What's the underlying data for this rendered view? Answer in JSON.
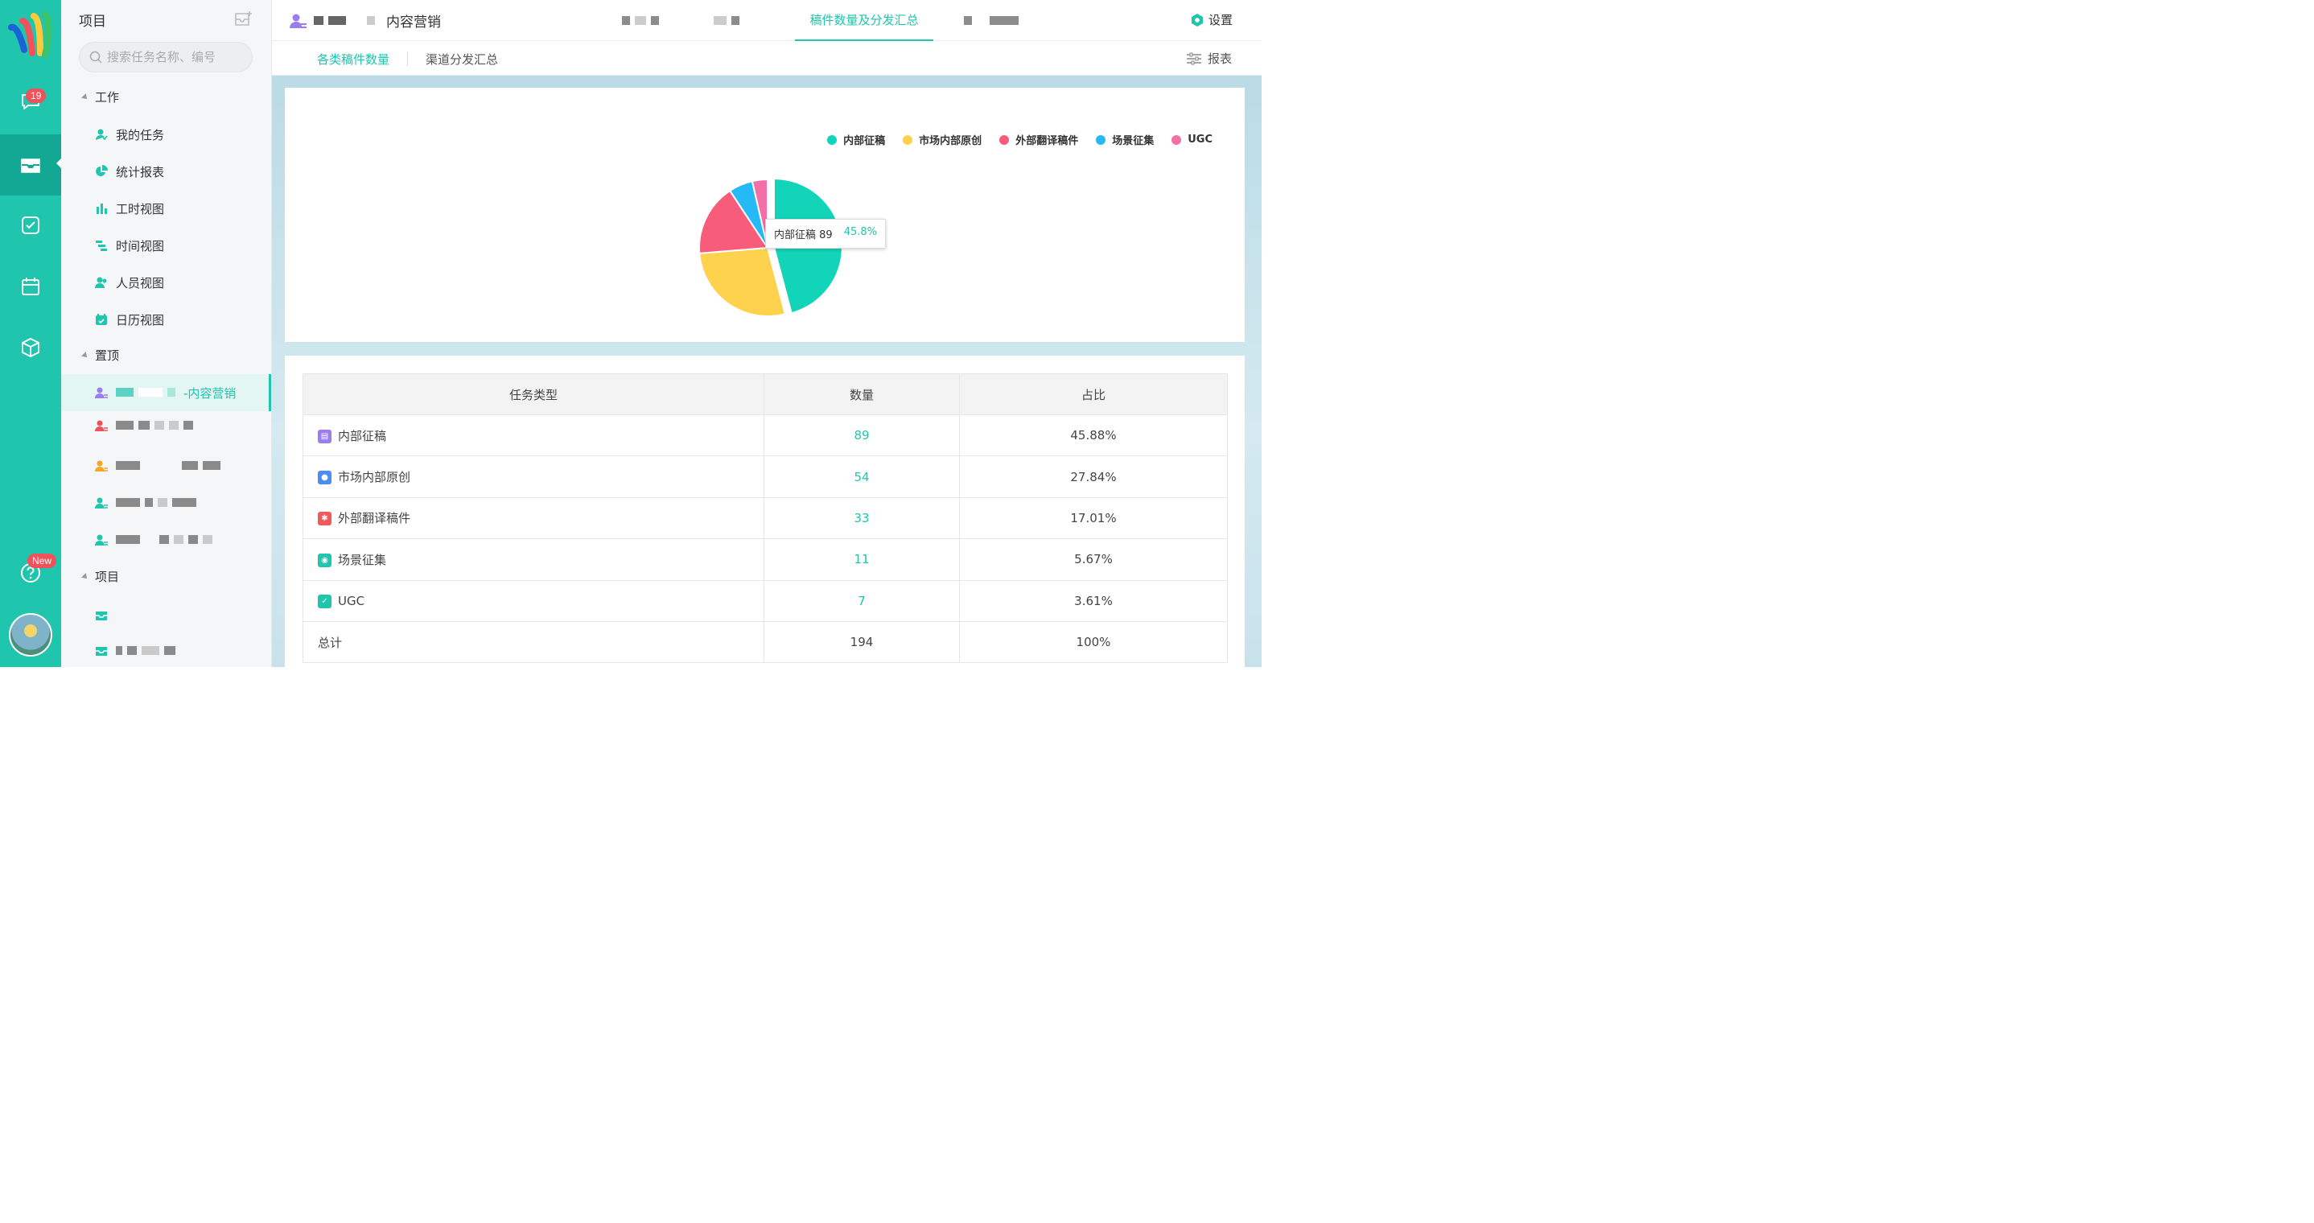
{
  "rail": {
    "chat_badge": "19",
    "help_badge": "New"
  },
  "sidebar": {
    "title": "项目",
    "search_placeholder": "搜索任务名称、编号",
    "sections": {
      "work": "工作",
      "pinned": "置顶",
      "projects": "项目"
    },
    "work_items": [
      {
        "label": "我的任务",
        "icon": "user-task-icon"
      },
      {
        "label": "统计报表",
        "icon": "pie-chart-icon"
      },
      {
        "label": "工时视图",
        "icon": "bar-chart-icon"
      },
      {
        "label": "时间视图",
        "icon": "gantt-icon"
      },
      {
        "label": "人员视图",
        "icon": "people-icon"
      },
      {
        "label": "日历视图",
        "icon": "calendar-icon"
      }
    ],
    "pinned_active_label": "-内容营销"
  },
  "header": {
    "project_title": "内容营销",
    "tabs": [
      {
        "label": "稿件数量及分发汇总",
        "active": true
      }
    ],
    "settings_label": "设置"
  },
  "subheader": {
    "tabs": [
      {
        "label": "各类稿件数量",
        "active": true
      },
      {
        "label": "渠道分发汇总",
        "active": false
      }
    ],
    "report_label": "报表"
  },
  "colors": {
    "accent": "#1fc5ac",
    "slices": [
      "#12d4b8",
      "#ffd24d",
      "#f75d7a",
      "#25b9f5",
      "#f46fa8"
    ]
  },
  "chart_data": {
    "type": "pie",
    "categories": [
      "内部征稿",
      "市场内部原创",
      "外部翻译稿件",
      "场景征集",
      "UGC"
    ],
    "values": [
      89,
      54,
      33,
      11,
      7
    ],
    "legend_position": "top-right",
    "tooltip": {
      "label": "内部征稿",
      "value": "89",
      "percent": "45.8%"
    }
  },
  "table": {
    "headers": [
      "任务类型",
      "数量",
      "占比"
    ],
    "rows": [
      {
        "name": "内部征稿",
        "count": "89",
        "pct": "45.88%",
        "tag_color": "#9b7df0",
        "icon": "doc-icon"
      },
      {
        "name": "市场内部原创",
        "count": "54",
        "pct": "27.84%",
        "tag_color": "#4a8df5",
        "icon": "apple-icon"
      },
      {
        "name": "外部翻译稿件",
        "count": "33",
        "pct": "17.01%",
        "tag_color": "#f05a5a",
        "icon": "bug-icon"
      },
      {
        "name": "场景征集",
        "count": "11",
        "pct": "5.67%",
        "tag_color": "#1fc5ac",
        "icon": "chat-icon"
      },
      {
        "name": "UGC",
        "count": "7",
        "pct": "3.61%",
        "tag_color": "#1fc5ac",
        "icon": "check-icon"
      }
    ],
    "total": {
      "label": "总计",
      "count": "194",
      "pct": "100%"
    }
  }
}
